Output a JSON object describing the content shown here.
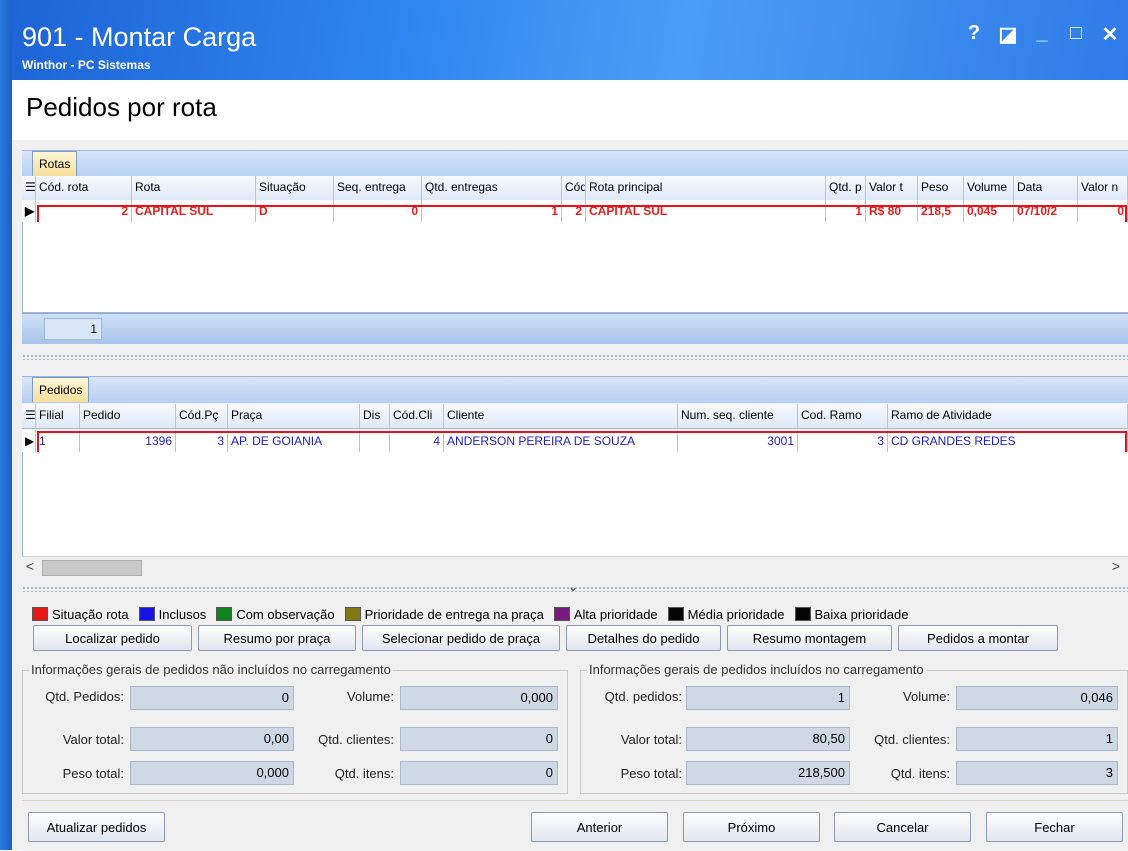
{
  "window": {
    "title": "901 - Montar Carga",
    "subtitle": "Winthor - PC Sistemas",
    "help_glyph": "?",
    "restore_glyph": "◪",
    "minimize_glyph": "_",
    "maximize_glyph": "□",
    "close_glyph": "✕"
  },
  "page_title": "Pedidos por rota",
  "rotas": {
    "tab_label": "Rotas",
    "columns": [
      "Cód. rota",
      "Rota",
      "Situação",
      "Seq. entrega",
      "Qtd. entregas",
      "Cód",
      "Rota principal",
      "Qtd. p",
      "Valor t",
      "Peso",
      "Volume",
      "Data",
      "Valor n"
    ],
    "rows": [
      [
        "2",
        "CAPITAL SUL",
        "D",
        "0",
        "1",
        "2",
        "CAPITAL SUL",
        "1",
        "R$ 80",
        "218,5",
        "0,045",
        "07/10/2",
        "0"
      ]
    ],
    "footer_count": "1"
  },
  "pedidos": {
    "tab_label": "Pedidos",
    "columns": [
      "Filial",
      "Pedido",
      "Cód.Pç",
      "Praça",
      "Dis",
      "Cód.Cli",
      "Cliente",
      "Num. seq. cliente",
      "Cod. Ramo",
      "Ramo de Atividade"
    ],
    "rows": [
      [
        "1",
        "1396",
        "3",
        "AP. DE GOIANIA",
        "",
        "4",
        "ANDERSON PEREIRA DE SOUZA",
        "3001",
        "3",
        "CD GRANDES REDES"
      ]
    ]
  },
  "scroll": {
    "left_arrow": "<",
    "right_arrow": ">",
    "splitter_glyph": "⌄"
  },
  "legend": [
    {
      "label": "Situação rota",
      "color": "#e81818"
    },
    {
      "label": "Inclusos",
      "color": "#1414e6"
    },
    {
      "label": "Com observação",
      "color": "#10821e"
    },
    {
      "label": "Prioridade de entrega na praça",
      "color": "#7f7a14"
    },
    {
      "label": "Alta prioridade",
      "color": "#7a1882"
    },
    {
      "label": "Média prioridade",
      "color": "#050505"
    },
    {
      "label": "Baixa prioridade",
      "color": "#050505"
    }
  ],
  "actions": {
    "localizar": "Localizar pedido",
    "resumo_praca": "Resumo por praça",
    "selecionar_praca": "Selecionar pedido de praça",
    "detalhes": "Detalhes do pedido",
    "resumo_montagem": "Resumo montagem",
    "pedidos_montar": "Pedidos a montar"
  },
  "nao_incluidos": {
    "title": "Informações gerais de pedidos não incluídos no carregamento",
    "qtd_pedidos_label": "Qtd. Pedidos:",
    "qtd_pedidos": "0",
    "volume_label": "Volume:",
    "volume": "0,000",
    "valor_total_label": "Valor total:",
    "valor_total": "0,00",
    "qtd_clientes_label": "Qtd. clientes:",
    "qtd_clientes": "0",
    "peso_total_label": "Peso total:",
    "peso_total": "0,000",
    "qtd_itens_label": "Qtd. itens:",
    "qtd_itens": "0"
  },
  "incluidos": {
    "title": "Informações gerais de pedidos incluídos no carregamento",
    "qtd_pedidos_label": "Qtd. pedidos:",
    "qtd_pedidos": "1",
    "volume_label": "Volume:",
    "volume": "0,046",
    "valor_total_label": "Valor total:",
    "valor_total": "80,50",
    "qtd_clientes_label": "Qtd. clientes:",
    "qtd_clientes": "1",
    "peso_total_label": "Peso total:",
    "peso_total": "218,500",
    "qtd_itens_label": "Qtd. itens:",
    "qtd_itens": "3"
  },
  "bottom": {
    "atualizar": "Atualizar pedidos",
    "anterior": "Anterior",
    "proximo": "Próximo",
    "cancelar": "Cancelar",
    "fechar": "Fechar"
  }
}
